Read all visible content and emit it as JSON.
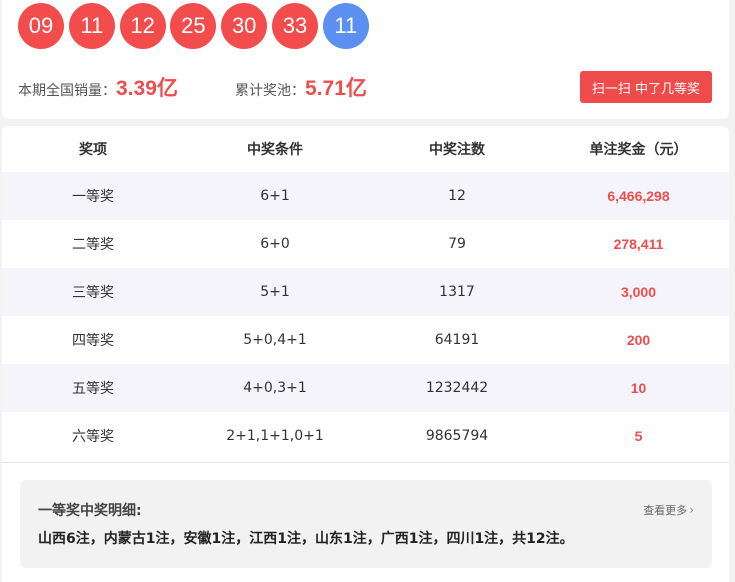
{
  "draw": {
    "red_balls": [
      "09",
      "11",
      "12",
      "25",
      "30",
      "33"
    ],
    "blue_ball": "11"
  },
  "stats": {
    "sales_label": "本期全国销量：",
    "sales_value": "3.39亿",
    "pool_label": "累计奖池：",
    "pool_value": "5.71亿"
  },
  "scan_button": "扫一扫 中了几等奖",
  "table": {
    "headers": [
      "奖项",
      "中奖条件",
      "中奖注数",
      "单注奖金（元）"
    ],
    "rows": [
      [
        "一等奖",
        "6+1",
        "12",
        "6,466,298"
      ],
      [
        "二等奖",
        "6+0",
        "79",
        "278,411"
      ],
      [
        "三等奖",
        "5+1",
        "1317",
        "3,000"
      ],
      [
        "四等奖",
        "5+0,4+1",
        "64191",
        "200"
      ],
      [
        "五等奖",
        "4+0,3+1",
        "1232442",
        "10"
      ],
      [
        "六等奖",
        "2+1,1+1,0+1",
        "9865794",
        "5"
      ]
    ]
  },
  "detail": {
    "title": "一等奖中奖明细:",
    "more_label": "查看更多",
    "text": "山西6注，内蒙古1注，安徽1注，江西1注，山东1注，广西1注，四川1注，共12注。"
  },
  "colors": {
    "red": "#ef4d4d",
    "blue": "#5b8ff0"
  }
}
